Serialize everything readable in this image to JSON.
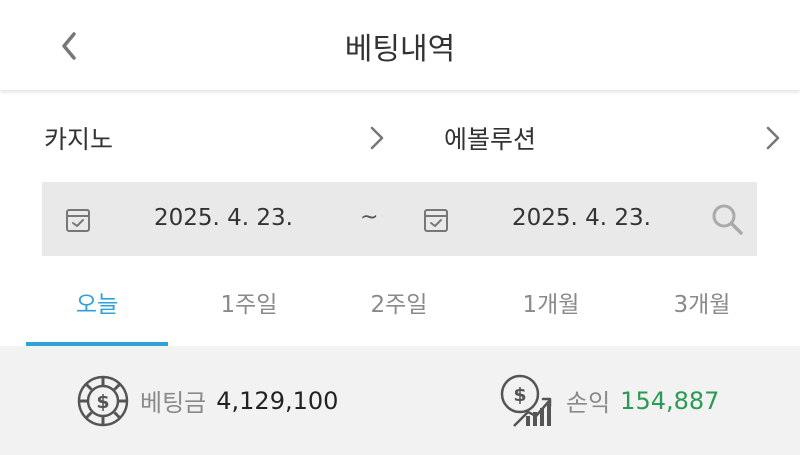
{
  "header": {
    "title": "베팅내역",
    "back_icon": "chevron-left-icon"
  },
  "filters": {
    "category": "카지노",
    "provider": "에볼루션"
  },
  "date_range": {
    "start": "2025. 4. 23.",
    "separator": "~",
    "end": "2025. 4. 23.",
    "calendar_icon": "calendar-check-icon",
    "search_icon": "search-icon"
  },
  "tabs": [
    {
      "label": "오늘",
      "active": true
    },
    {
      "label": "1주일",
      "active": false
    },
    {
      "label": "2주일",
      "active": false
    },
    {
      "label": "1개월",
      "active": false
    },
    {
      "label": "3개월",
      "active": false
    }
  ],
  "summary": {
    "bet_label": "베팅금",
    "bet_value": "4,129,100",
    "profit_label": "손익",
    "profit_value": "154,887"
  },
  "colors": {
    "accent": "#2ea3d6",
    "profit": "#2a9a55",
    "date_bg": "#e9e9e9",
    "summary_bg": "#f2f2f2"
  }
}
